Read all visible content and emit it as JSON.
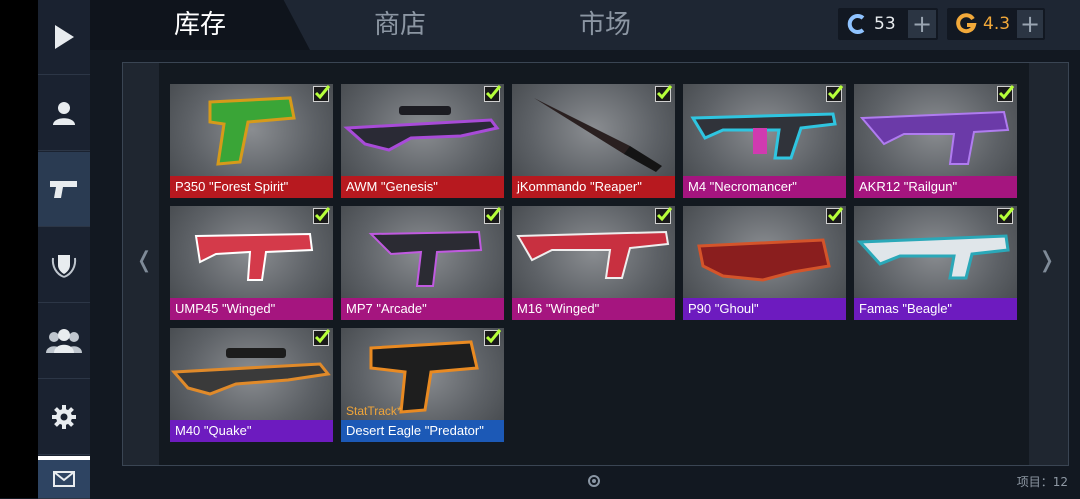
{
  "tabs": [
    {
      "label": "库存",
      "active": true
    },
    {
      "label": "商店",
      "active": false
    },
    {
      "label": "市场",
      "active": false
    }
  ],
  "currency": {
    "credits": {
      "icon": "c-coin-icon",
      "value": "53",
      "color": "#8fc3ff"
    },
    "gold": {
      "icon": "g-coin-icon",
      "value": "4.3",
      "color": "#f2a93a"
    }
  },
  "sidebar": [
    {
      "name": "play",
      "icon": "play-icon"
    },
    {
      "name": "profile",
      "icon": "person-icon"
    },
    {
      "name": "inventory",
      "icon": "pistol-icon",
      "active": true
    },
    {
      "name": "clan",
      "icon": "laurel-shield-icon"
    },
    {
      "name": "friends",
      "icon": "group-icon"
    },
    {
      "name": "settings",
      "icon": "gear-icon"
    },
    {
      "name": "mail",
      "icon": "envelope-icon"
    }
  ],
  "items": [
    {
      "name": "P350 \"Forest Spirit\"",
      "rarity": "red",
      "color": "#b7191f",
      "weapon": "pistol"
    },
    {
      "name": "AWM \"Genesis\"",
      "rarity": "red",
      "color": "#b7191f",
      "weapon": "sniper"
    },
    {
      "name": "jKommando \"Reaper\"",
      "rarity": "red",
      "color": "#b7191f",
      "weapon": "knife"
    },
    {
      "name": "M4 \"Necromancer\"",
      "rarity": "pink",
      "color": "#a5157f",
      "weapon": "rifle"
    },
    {
      "name": "AKR12 \"Railgun\"",
      "rarity": "pink",
      "color": "#a5157f",
      "weapon": "ak"
    },
    {
      "name": "UMP45 \"Winged\"",
      "rarity": "pink",
      "color": "#a5157f",
      "weapon": "smg"
    },
    {
      "name": "MP7 \"Arcade\"",
      "rarity": "pink",
      "color": "#a5157f",
      "weapon": "smg2"
    },
    {
      "name": "M16 \"Winged\"",
      "rarity": "pink",
      "color": "#a5157f",
      "weapon": "rifle2"
    },
    {
      "name": "P90 \"Ghoul\"",
      "rarity": "purple",
      "color": "#6d1bbf",
      "weapon": "p90"
    },
    {
      "name": "Famas \"Beagle\"",
      "rarity": "purple",
      "color": "#6d1bbf",
      "weapon": "famas"
    },
    {
      "name": "M40 \"Quake\"",
      "rarity": "purple",
      "color": "#6d1bbf",
      "weapon": "sniper2"
    },
    {
      "name": "Desert Eagle \"Predator\"",
      "rarity": "blue",
      "color": "#1c59b6",
      "weapon": "deagle",
      "stattrack": "StatTrack*"
    }
  ],
  "footer": {
    "items_count": "项目：12"
  }
}
